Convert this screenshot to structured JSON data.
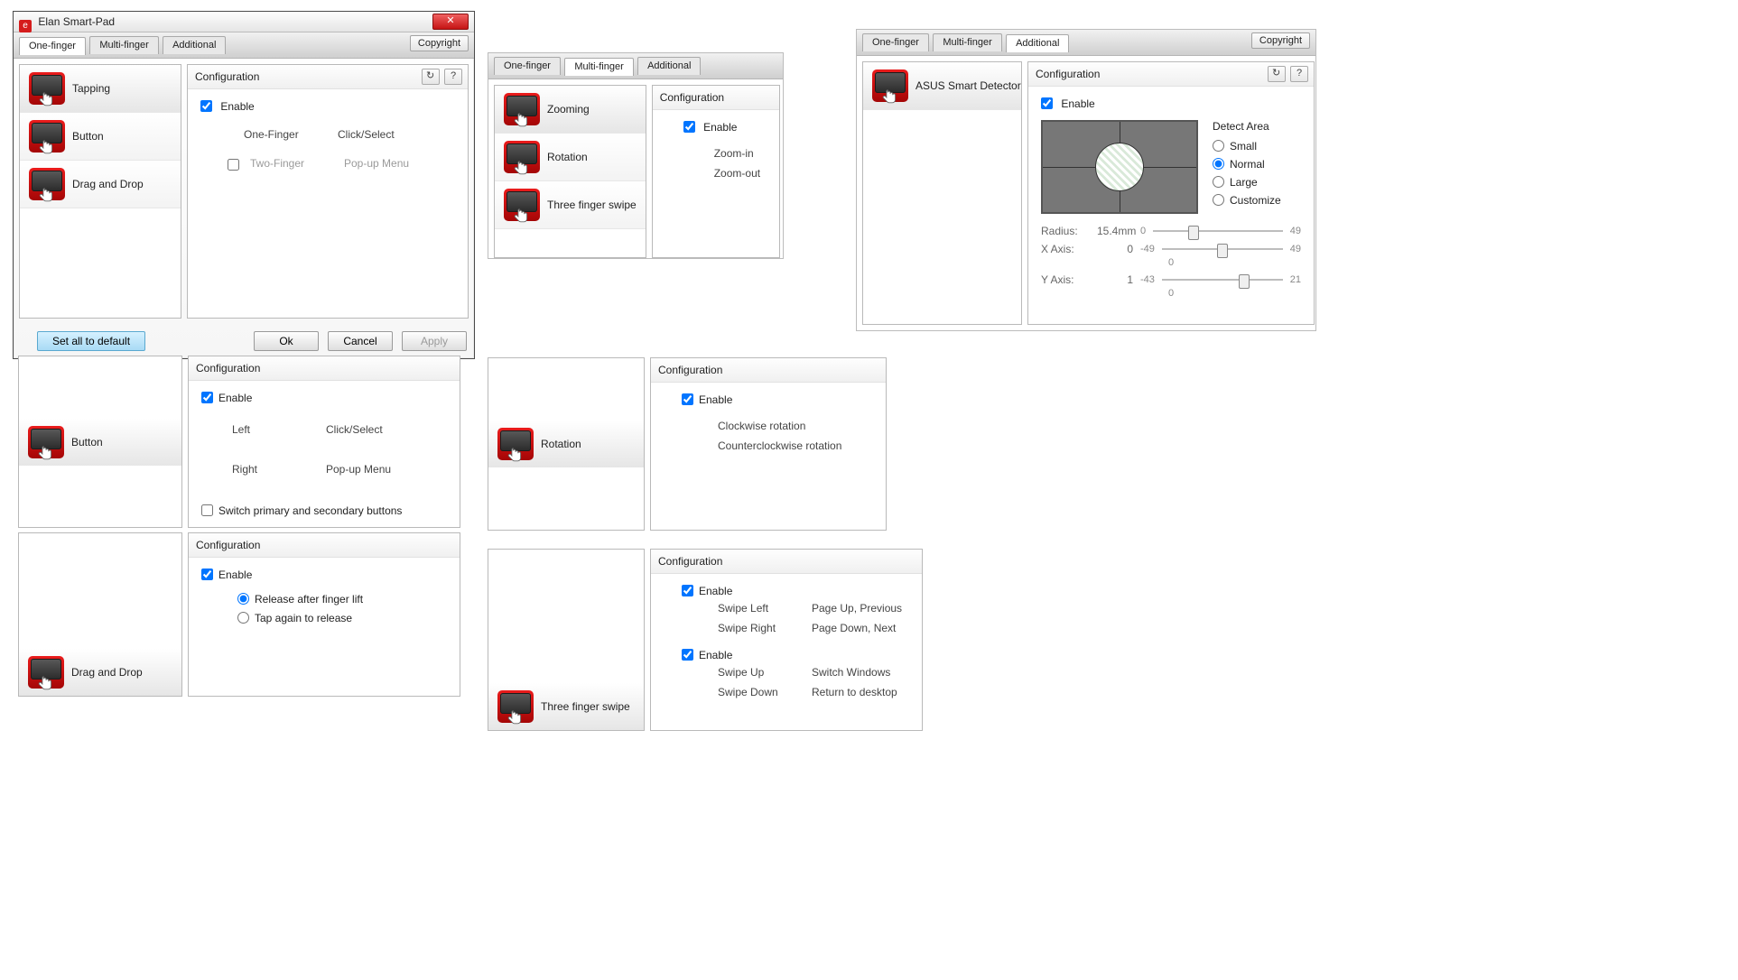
{
  "main_window": {
    "title": "Elan Smart-Pad",
    "tabs": [
      "One-finger",
      "Multi-finger",
      "Additional"
    ],
    "active_tab": "One-finger",
    "copyright_btn": "Copyright",
    "list": [
      {
        "label": "Tapping",
        "selected": true
      },
      {
        "label": "Button",
        "selected": false
      },
      {
        "label": "Drag and Drop",
        "selected": false
      }
    ],
    "conf": {
      "title": "Configuration",
      "enable_label": "Enable",
      "enabled": true,
      "rows": [
        {
          "k": "One-Finger",
          "v": "Click/Select",
          "checkbox": false,
          "disabled": false
        },
        {
          "k": "Two-Finger",
          "v": "Pop-up Menu",
          "checkbox": true,
          "checked": false,
          "disabled": true
        }
      ]
    },
    "buttons": {
      "default": "Set all to default",
      "ok": "Ok",
      "cancel": "Cancel",
      "apply": "Apply"
    }
  },
  "multi_window": {
    "tabs": [
      "One-finger",
      "Multi-finger",
      "Additional"
    ],
    "active_tab": "Multi-finger",
    "list": [
      {
        "label": "Zooming",
        "selected": true
      },
      {
        "label": "Rotation",
        "selected": false
      },
      {
        "label": "Three finger swipe",
        "selected": false
      }
    ],
    "conf": {
      "title": "Configuration",
      "enable_label": "Enable",
      "enabled": true,
      "rows": [
        {
          "k": "",
          "v": "Zoom-in"
        },
        {
          "k": "",
          "v": "Zoom-out"
        }
      ]
    }
  },
  "additional_window": {
    "tabs": [
      "One-finger",
      "Multi-finger",
      "Additional"
    ],
    "active_tab": "Additional",
    "copyright_btn": "Copyright",
    "list": [
      {
        "label": "ASUS Smart Detector",
        "selected": true
      }
    ],
    "conf": {
      "title": "Configuration",
      "enable_label": "Enable",
      "enabled": true
    },
    "detect": {
      "title": "Detect Area",
      "options": [
        "Small",
        "Normal",
        "Large",
        "Customize"
      ],
      "selected": "Normal"
    },
    "sliders": {
      "radius": {
        "label": "Radius:",
        "value": "15.4mm",
        "min": "0",
        "max": "49",
        "thumb_pct": 31
      },
      "xaxis": {
        "label": "X Axis:",
        "value": "0",
        "min": "-49",
        "max": "49",
        "thumb_pct": 50,
        "center": "0"
      },
      "yaxis": {
        "label": "Y Axis:",
        "value": "1",
        "min": "-43",
        "max": "21",
        "thumb_pct": 68,
        "center": "0"
      }
    }
  },
  "button_panel": {
    "list": [
      {
        "label": "Button"
      }
    ],
    "conf": {
      "title": "Configuration",
      "enable_label": "Enable",
      "enabled": true,
      "rows": [
        {
          "k": "Left",
          "v": "Click/Select"
        },
        {
          "k": "Right",
          "v": "Pop-up Menu"
        }
      ],
      "switch_label": "Switch primary and secondary buttons",
      "switch_checked": false
    }
  },
  "drag_panel": {
    "list": [
      {
        "label": "Drag and Drop"
      }
    ],
    "conf": {
      "title": "Configuration",
      "enable_label": "Enable",
      "enabled": true,
      "radios": [
        {
          "label": "Release after finger lift",
          "checked": true
        },
        {
          "label": "Tap again to release",
          "checked": false
        }
      ]
    }
  },
  "rotation_panel": {
    "list": [
      {
        "label": "Rotation"
      }
    ],
    "conf": {
      "title": "Configuration",
      "enable_label": "Enable",
      "enabled": true,
      "rows": [
        {
          "k": "",
          "v": "Clockwise rotation"
        },
        {
          "k": "",
          "v": "Counterclockwise rotation"
        }
      ]
    }
  },
  "swipe_panel": {
    "list": [
      {
        "label": "Three finger swipe"
      }
    ],
    "conf": {
      "title": "Configuration",
      "groups": [
        {
          "enable_label": "Enable",
          "enabled": true,
          "rows": [
            {
              "k": "Swipe Left",
              "v": "Page Up, Previous"
            },
            {
              "k": "Swipe Right",
              "v": "Page Down, Next"
            }
          ]
        },
        {
          "enable_label": "Enable",
          "enabled": true,
          "rows": [
            {
              "k": "Swipe Up",
              "v": "Switch Windows"
            },
            {
              "k": "Swipe Down",
              "v": "Return to desktop"
            }
          ]
        }
      ]
    }
  }
}
